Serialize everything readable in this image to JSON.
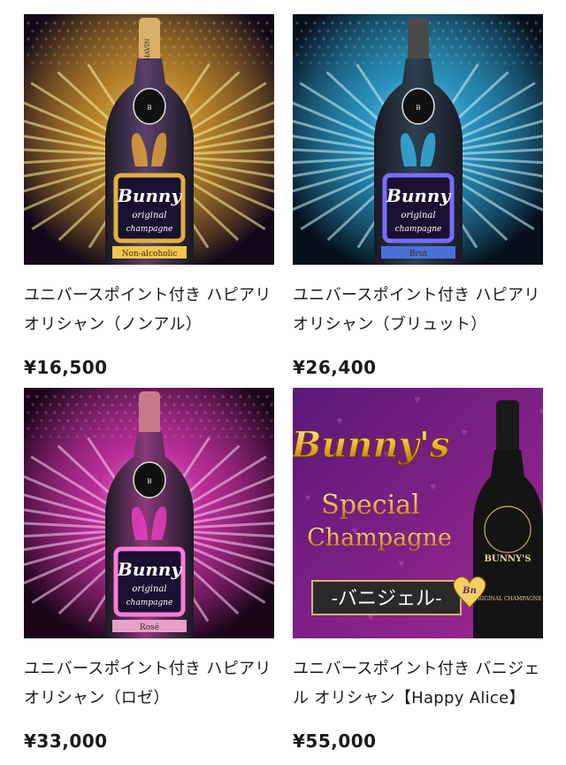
{
  "products": [
    {
      "title": "ユニバースポイント付き ハピアリオリシャン（ノンアル）",
      "price": "¥16,500",
      "image": {
        "kind": "bunny-bottle",
        "bg": "#12081a",
        "glow": "#ffb830",
        "glow2": "#fff0a0",
        "bottle": "#5a3f6a",
        "neck": "#d9b06a",
        "frame": "#e0b040",
        "badge_text": "Non-alcoholic",
        "badge_color": "#f2c84a",
        "label_top": "Bunny",
        "label_mid": "original",
        "label_bot": "champagne",
        "neck_text": "HAVIN"
      }
    },
    {
      "title": "ユニバースポイント付き ハピアリオリシャン（ブリュット）",
      "price": "¥26,400",
      "image": {
        "kind": "bunny-bottle",
        "bg": "#06101c",
        "glow": "#38c8ff",
        "glow2": "#c8f4ff",
        "bottle": "#2c4050",
        "neck": "#4a4a4a",
        "frame": "#7a6cff",
        "badge_text": "Brut",
        "badge_color": "#4a70d8",
        "label_top": "Bunny",
        "label_mid": "original",
        "label_bot": "champagne",
        "neck_text": ""
      }
    },
    {
      "title": "ユニバースポイント付き ハピアリオリシャン（ロゼ）",
      "price": "¥33,000",
      "image": {
        "kind": "bunny-bottle",
        "bg": "#1a0618",
        "glow": "#ff40d0",
        "glow2": "#ffd0f6",
        "bottle": "#8a3a7a",
        "neck": "#c87a8a",
        "frame": "#ff7ad8",
        "badge_text": "Rosé",
        "badge_color": "#e8a0c8",
        "label_top": "Bunny",
        "label_mid": "original",
        "label_bot": "champagne",
        "neck_text": ""
      }
    },
    {
      "title": "ユニバースポイント付き バニジェル オリシャン【Happy Alice】",
      "price": "¥55,000",
      "image": {
        "kind": "special-banner",
        "bg": "#5a1878",
        "bg2": "#a02890",
        "headline": "Bunny's",
        "line1": "Special",
        "line2": "Champagne",
        "ribbon": "-バニジェル-",
        "bottle_label": "BUNNY'S",
        "bottle_sub": "ORIGINAL CHAMPAGNE",
        "heart_text": "Bn"
      }
    }
  ]
}
